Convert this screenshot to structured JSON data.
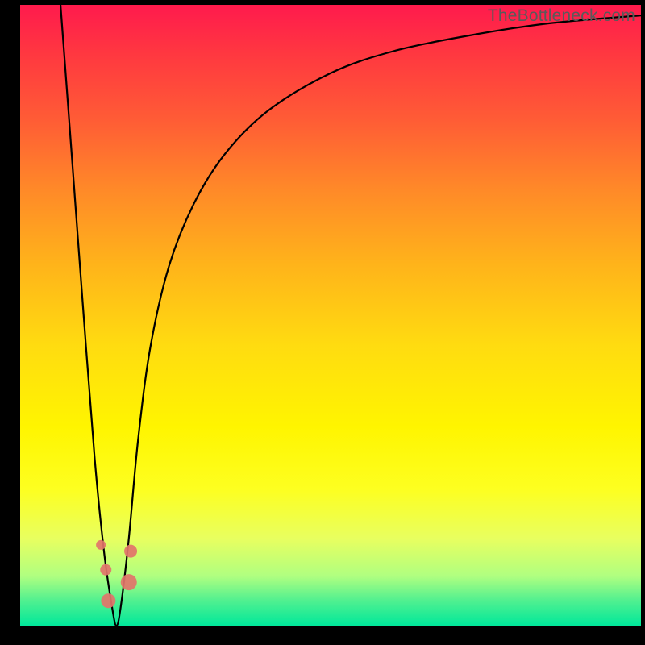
{
  "watermark": "TheBottleneck.com",
  "chart_data": {
    "type": "line",
    "title": "",
    "xlabel": "",
    "ylabel": "",
    "xlim": [
      0,
      100
    ],
    "ylim": [
      0,
      100
    ],
    "gradient_stops": [
      {
        "pos": 0,
        "color": "#ff1a4d"
      },
      {
        "pos": 8,
        "color": "#ff3840"
      },
      {
        "pos": 18,
        "color": "#ff5a36"
      },
      {
        "pos": 30,
        "color": "#ff8a28"
      },
      {
        "pos": 42,
        "color": "#ffb41a"
      },
      {
        "pos": 55,
        "color": "#ffdc10"
      },
      {
        "pos": 68,
        "color": "#fff500"
      },
      {
        "pos": 78,
        "color": "#fdff20"
      },
      {
        "pos": 86,
        "color": "#e8ff60"
      },
      {
        "pos": 92,
        "color": "#b0ff80"
      },
      {
        "pos": 96,
        "color": "#50f090"
      },
      {
        "pos": 100,
        "color": "#00e89a"
      }
    ],
    "series": [
      {
        "name": "bottleneck-curve",
        "x": [
          6.5,
          8,
          10,
          12,
          13.5,
          14.8,
          15.5,
          16.2,
          17.5,
          19,
          21,
          24,
          28,
          33,
          40,
          50,
          60,
          72,
          85,
          100
        ],
        "y": [
          100,
          80,
          53,
          27,
          12,
          3,
          0,
          3,
          14,
          30,
          45,
          58,
          68,
          76,
          83,
          89,
          92.5,
          95,
          97,
          98.3
        ]
      }
    ],
    "markers": [
      {
        "name": "point-a",
        "x": 13.0,
        "y": 13,
        "r": 6
      },
      {
        "name": "point-b",
        "x": 13.8,
        "y": 9,
        "r": 7
      },
      {
        "name": "point-c",
        "x": 14.2,
        "y": 4,
        "r": 9
      },
      {
        "name": "point-d",
        "x": 17.5,
        "y": 7,
        "r": 10
      },
      {
        "name": "point-e",
        "x": 17.8,
        "y": 12,
        "r": 8
      }
    ],
    "marker_color": "#e2746a"
  }
}
